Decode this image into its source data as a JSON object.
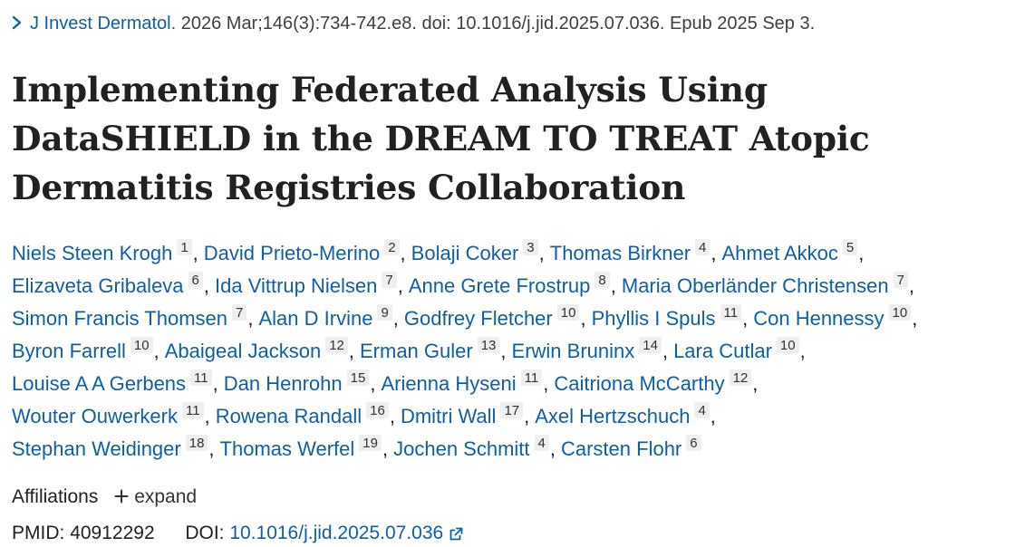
{
  "citation": {
    "journal": "J Invest Dermatol.",
    "details": " 2026 Mar;146(3):734-742.e8. doi: 10.1016/j.jid.2025.07.036. Epub 2025 Sep 3."
  },
  "title": "Implementing Federated Analysis Using DataSHIELD in the DREAM TO TREAT Atopic Dermatitis Registries Collaboration",
  "authors_lines": [
    [
      {
        "name": "Niels Steen Krogh",
        "aff": "1"
      },
      {
        "name": "David Prieto-Merino",
        "aff": "2"
      },
      {
        "name": "Bolaji Coker",
        "aff": "3"
      },
      {
        "name": "Thomas Birkner",
        "aff": "4"
      },
      {
        "name": "Ahmet Akkoc",
        "aff": "5"
      }
    ],
    [
      {
        "name": "Elizaveta Gribaleva",
        "aff": "6"
      },
      {
        "name": "Ida Vittrup Nielsen",
        "aff": "7"
      },
      {
        "name": "Anne Grete Frostrup",
        "aff": "8"
      },
      {
        "name": "Maria Oberländer Christensen",
        "aff": "7"
      }
    ],
    [
      {
        "name": "Simon Francis Thomsen",
        "aff": "7"
      },
      {
        "name": "Alan D Irvine",
        "aff": "9"
      },
      {
        "name": "Godfrey Fletcher",
        "aff": "10"
      },
      {
        "name": "Phyllis I Spuls",
        "aff": "11"
      },
      {
        "name": "Con Hennessy",
        "aff": "10"
      }
    ],
    [
      {
        "name": "Byron Farrell",
        "aff": "10"
      },
      {
        "name": "Abaigeal Jackson",
        "aff": "12"
      },
      {
        "name": "Erman Guler",
        "aff": "13"
      },
      {
        "name": "Erwin Bruninx",
        "aff": "14"
      },
      {
        "name": "Lara Cutlar",
        "aff": "10"
      }
    ],
    [
      {
        "name": "Louise A A Gerbens",
        "aff": "11"
      },
      {
        "name": "Dan Henrohn",
        "aff": "15"
      },
      {
        "name": "Arienna Hyseni",
        "aff": "11"
      },
      {
        "name": "Caitriona McCarthy",
        "aff": "12"
      }
    ],
    [
      {
        "name": "Wouter Ouwerkerk",
        "aff": "11"
      },
      {
        "name": "Rowena Randall",
        "aff": "16"
      },
      {
        "name": "Dmitri Wall",
        "aff": "17"
      },
      {
        "name": "Axel Hertzschuch",
        "aff": "4"
      }
    ],
    [
      {
        "name": "Stephan Weidinger",
        "aff": "18"
      },
      {
        "name": "Thomas Werfel",
        "aff": "19"
      },
      {
        "name": "Jochen Schmitt",
        "aff": "4"
      },
      {
        "name": "Carsten Flohr",
        "aff": "6"
      }
    ]
  ],
  "affiliations": {
    "label": "Affiliations",
    "expand_label": "expand",
    "expand_icon": "plus-icon"
  },
  "ids": {
    "pmid_label": "PMID:",
    "pmid": "40912292",
    "doi_label": "DOI:",
    "doi": "10.1016/j.jid.2025.07.036",
    "doi_icon": "external-link-icon"
  },
  "colors": {
    "link": "#0d5fa8",
    "text": "#212121",
    "badge_bg": "#efefef"
  }
}
